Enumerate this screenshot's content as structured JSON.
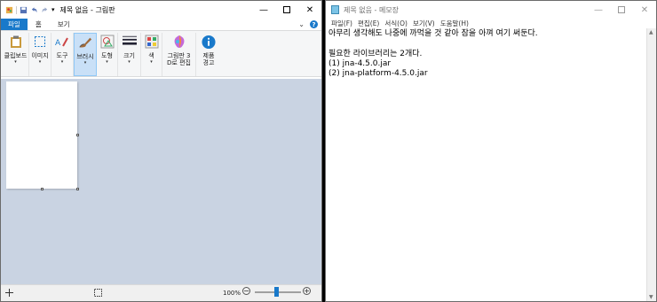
{
  "paint": {
    "title": "제목 없음 - 그림판",
    "tabs": [
      "파일",
      "홈",
      "보기"
    ],
    "ribbon": {
      "clipboard": "클립보드",
      "image": "이미지",
      "tools": "도구",
      "brushes": "브러시",
      "shapes": "도형",
      "size": "크기",
      "colors": "색",
      "paint3d_line1": "그림판 3",
      "paint3d_line2": "D로 편집",
      "product_line1": "제품",
      "product_line2": "경고"
    },
    "status": {
      "zoom": "100%"
    },
    "colors": {
      "accent": "#1979ca",
      "canvas_bg": "#c9d3e2"
    }
  },
  "notepad": {
    "title": "제목 없음 - 메모장",
    "menu": [
      "파일(F)",
      "편집(E)",
      "서식(O)",
      "보기(V)",
      "도움말(H)"
    ],
    "lines": [
      "아무리 생각해도 나중에 까먹을 것 같아 잠을 아껴 여기 써둔다.",
      "",
      "필요한 라이브러리는 2개다.",
      "(1) jna-4.5.0.jar",
      "(2) jna-platform-4.5.0.jar"
    ]
  }
}
